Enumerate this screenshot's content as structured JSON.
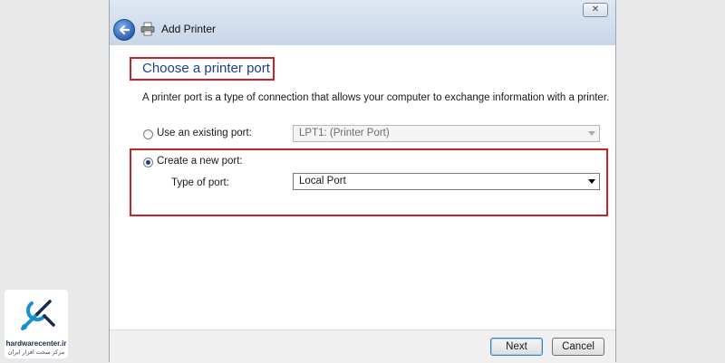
{
  "window": {
    "title": "Add Printer",
    "close_glyph": "✕"
  },
  "page": {
    "heading": "Choose a printer port",
    "description": "A printer port is a type of connection that allows your computer to exchange information with a printer."
  },
  "options": {
    "existing_port": {
      "label": "Use an existing port:",
      "selected": false,
      "select_value": "LPT1: (Printer Port)",
      "enabled": false
    },
    "new_port": {
      "label": "Create a new port:",
      "selected": true,
      "type_label": "Type of port:",
      "select_value": "Local Port",
      "enabled": true
    }
  },
  "buttons": {
    "next": "Next",
    "cancel": "Cancel"
  },
  "watermark": {
    "site": "hardwarecenter.ir",
    "tagline": "مرکز سخت افزار ایران"
  },
  "colors": {
    "highlight_box": "#c8212a",
    "heading_text": "#1e3f8a",
    "titlebar": "#c7d6e8"
  },
  "icons": {
    "back": "back-arrow-icon",
    "printer": "printer-icon",
    "close": "close-icon",
    "dropdown": "chevron-down-icon"
  }
}
